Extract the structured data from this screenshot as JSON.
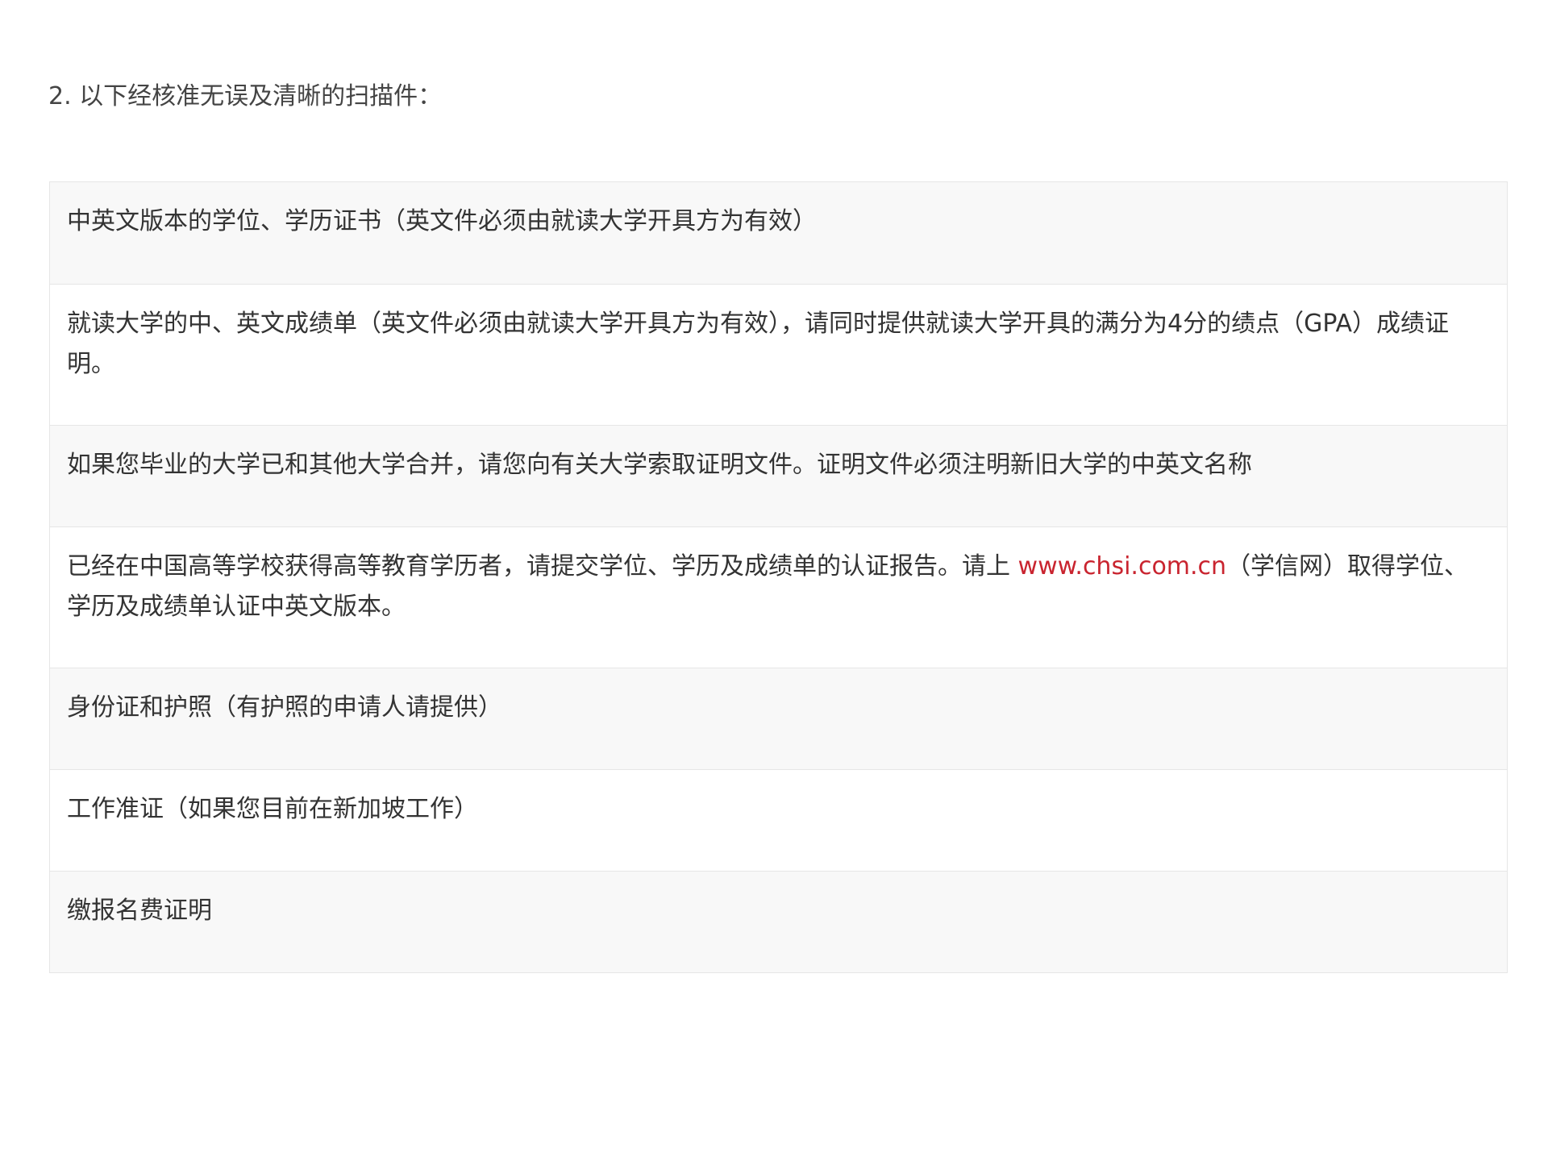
{
  "intro_text": "2. 以下经核准无误及清晰的扫描件：",
  "rows": [
    {
      "text": "中英文版本的学位、学历证书（英文件必须由就读大学开具方为有效）"
    },
    {
      "text": "就读大学的中、英文成绩单（英文件必须由就读大学开具方为有效），请同时提供就读大学开具的满分为4分的绩点（GPA）成绩证明。"
    },
    {
      "text": "如果您毕业的大学已和其他大学合并，请您向有关大学索取证明文件。证明文件必须注明新旧大学的中英文名称"
    },
    {
      "text_before": "已经在中国高等学校获得高等教育学历者，请提交学位、学历及成绩单的认证报告。请上 ",
      "link_text": "www.chsi.com.cn",
      "text_after": "（学信网）取得学位、学历及成绩单认证中英文版本。"
    },
    {
      "text": "身份证和护照（有护照的申请人请提供）"
    },
    {
      "text": "工作准证（如果您目前在新加坡工作）"
    },
    {
      "text": "缴报名费证明"
    }
  ],
  "colors": {
    "link": "#c9242f",
    "row_shade": "#f8f8f8",
    "border": "#e6e6e6",
    "text": "#333333"
  }
}
